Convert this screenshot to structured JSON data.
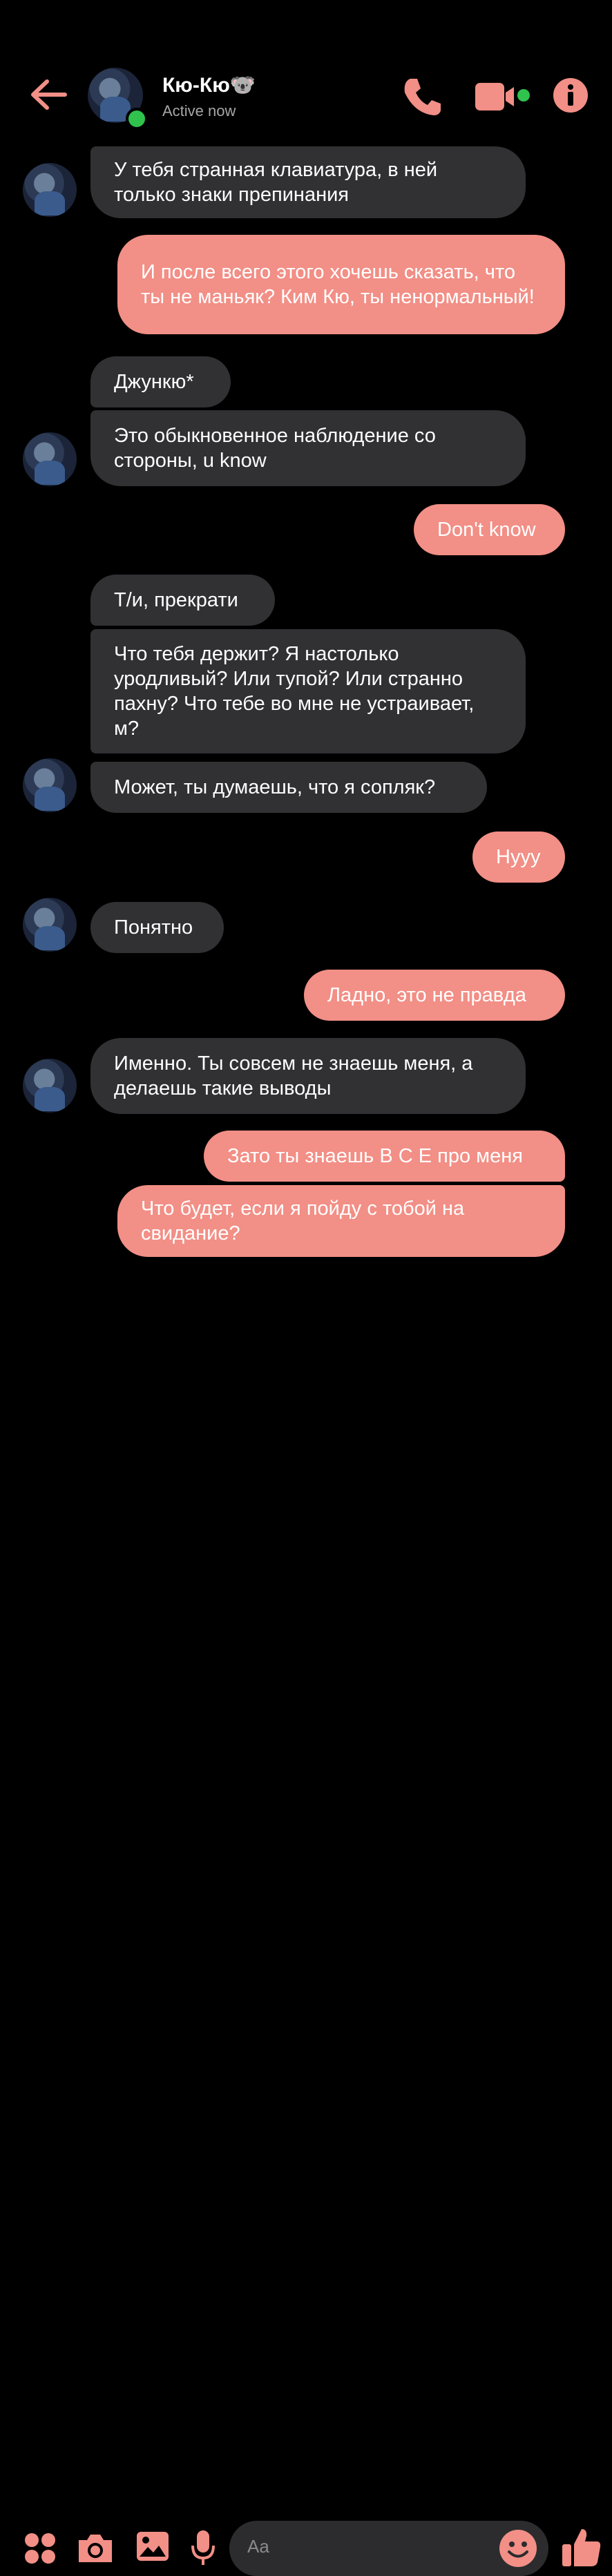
{
  "header": {
    "name": "Кю-Кю🐨",
    "status": "Active now"
  },
  "messages": [
    {
      "side": "in",
      "text": "У тебя странная клавиатура, в ней только знаки препинания"
    },
    {
      "side": "out",
      "text": "И после всего этого хочешь сказать, что ты не маньяк? Ким Кю, ты ненормальный!"
    },
    {
      "side": "in",
      "text": "Джункю*"
    },
    {
      "side": "in",
      "text": "Это обыкновенное наблюдение со стороны, u know"
    },
    {
      "side": "out",
      "text": "Don't know"
    },
    {
      "side": "in",
      "text": "Т/и, прекрати"
    },
    {
      "side": "in",
      "text": "Что тебя держит? Я настолько уродливый? Или тупой? Или странно пахну? Что тебе во мне не устраивает, м?"
    },
    {
      "side": "in",
      "text": "Может, ты думаешь, что я сопляк?"
    },
    {
      "side": "out",
      "text": "Нууу"
    },
    {
      "side": "in",
      "text": "Понятно"
    },
    {
      "side": "out",
      "text": "Ладно, это не правда"
    },
    {
      "side": "in",
      "text": "Именно. Ты совсем не знаешь меня, а делаешь такие выводы"
    },
    {
      "side": "out",
      "text": "Зато ты знаешь В С Е про меня"
    },
    {
      "side": "out",
      "text": "Что будет, если я пойду с тобой на свидание?"
    }
  ],
  "composer": {
    "placeholder": "Aa"
  },
  "colors": {
    "accent": "#f28f86",
    "incoming_bubble": "#313033",
    "online": "#31c24d"
  },
  "icons": [
    "back-arrow-icon",
    "phone-icon",
    "video-icon",
    "info-icon",
    "apps-icon",
    "camera-icon",
    "image-icon",
    "mic-icon",
    "emoji-icon",
    "thumbs-up-icon"
  ]
}
